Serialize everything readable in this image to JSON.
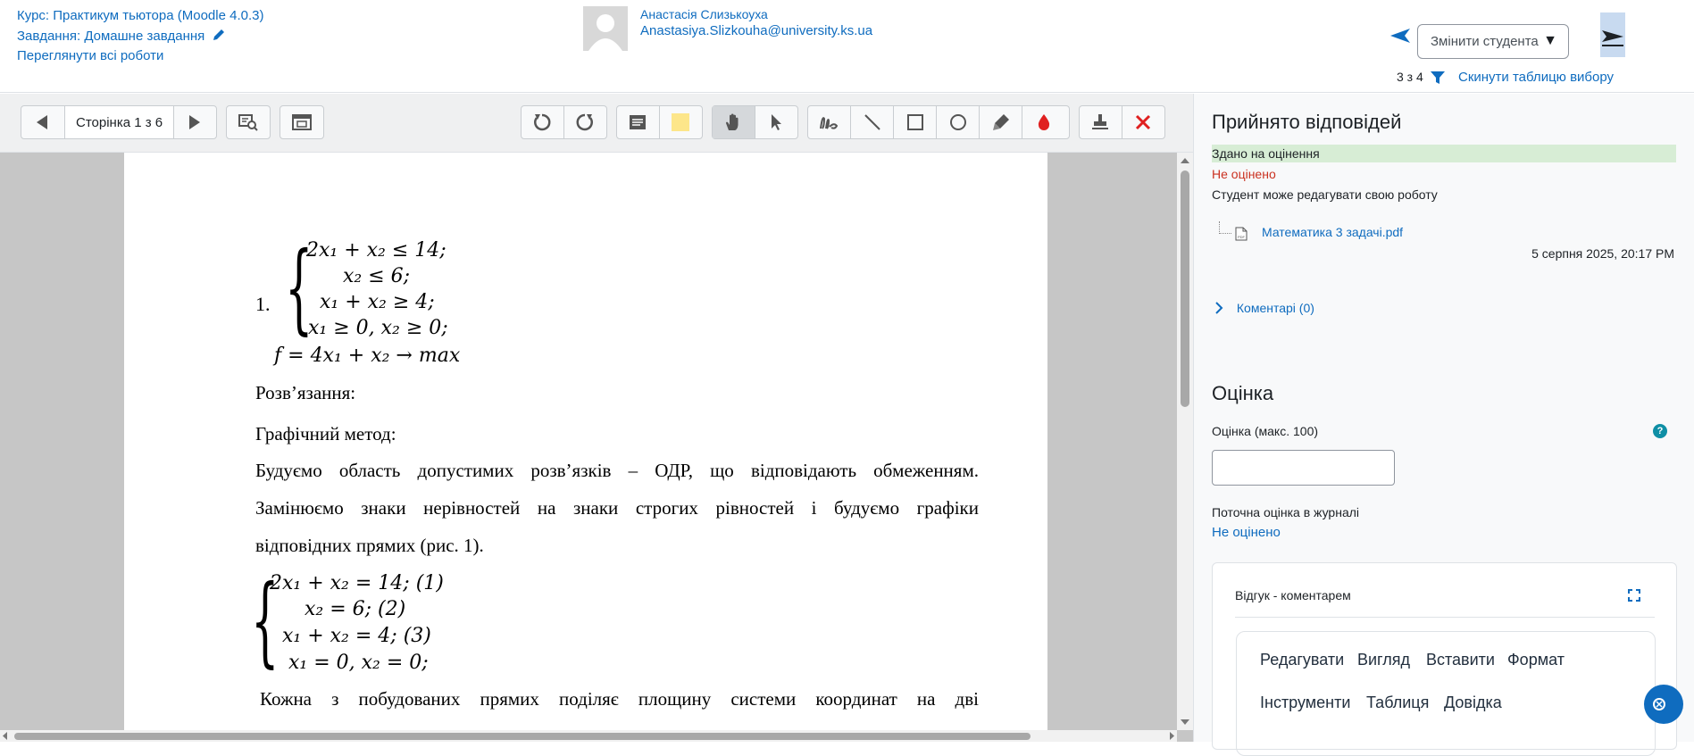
{
  "header": {
    "course": "Курс: Практикум тьютора (Moodle 4.0.3)",
    "assignment": "Завдання: Домашне завдання",
    "view_all": "Переглянути всі роботи",
    "user_name": "Анастасія Слизькоуха",
    "user_email": "Anastasiya.Slizkouha@university.ks.ua",
    "change_student": "Змінити студента",
    "count": "3 з 4",
    "reset_filter": "Скинути таблицю вибору"
  },
  "toolbar": {
    "page_label": "Сторінка 1 з 6",
    "highlight_color": "#fde68a",
    "delete_color": "#e02020",
    "ink_color": "#e02020"
  },
  "document": {
    "system1": [
      "2x₁ + x₂ ≤ 14;",
      "x₂ ≤ 6;",
      "x₁ + x₂ ≥ 4;",
      "x₁ ≥ 0, x₂ ≥ 0;"
    ],
    "item_number": "1.",
    "objective": "f = 4x₁ + x₂ → max",
    "solution": "Розв’язання:",
    "method": "Графічний метод:",
    "para1": "Будуємо область допустимих розв’язків – ОДР, що відповідають обмеженням.",
    "para2_line1": "Замінюємо знаки нерівностей на знаки строгих рівностей і будуємо графіки",
    "para2_line2": "відповідних прямих (рис. 1).",
    "system2": [
      "2x₁ + x₂ = 14; (1)",
      "x₂ = 6; (2)",
      "x₁ + x₂ = 4; (3)",
      "x₁ = 0, x₂ = 0;"
    ],
    "para3_line1": "Кожна з побудованих прямих поділяє площину системи координат на дві"
  },
  "panel": {
    "title": "Прийнято відповідей",
    "status_submitted": "Здано на оцінення",
    "status_grade": "Не оцінено",
    "status_edit": "Студент може редагувати свою роботу",
    "file_name": "Математика 3 задачі.pdf",
    "file_date": "5 серпня 2025, 20:17 PM",
    "comments": "Коментарі (0)",
    "grade_title": "Оцінка",
    "grade_label": "Оцінка (макс. 100)",
    "grade_value": "",
    "current_grade_label": "Поточна оцінка в журналі",
    "current_grade": "Не оцінено",
    "feedback_title": "Відгук - коментарем",
    "editor_menu": [
      "Редагувати",
      "Вигляд",
      "Вставити",
      "Формат",
      "Інструменти",
      "Таблиця",
      "Довідка"
    ]
  },
  "colors": {
    "link": "#0f6cbf",
    "submitted_bg": "#d7edd5",
    "not_graded": "#ca3120"
  }
}
